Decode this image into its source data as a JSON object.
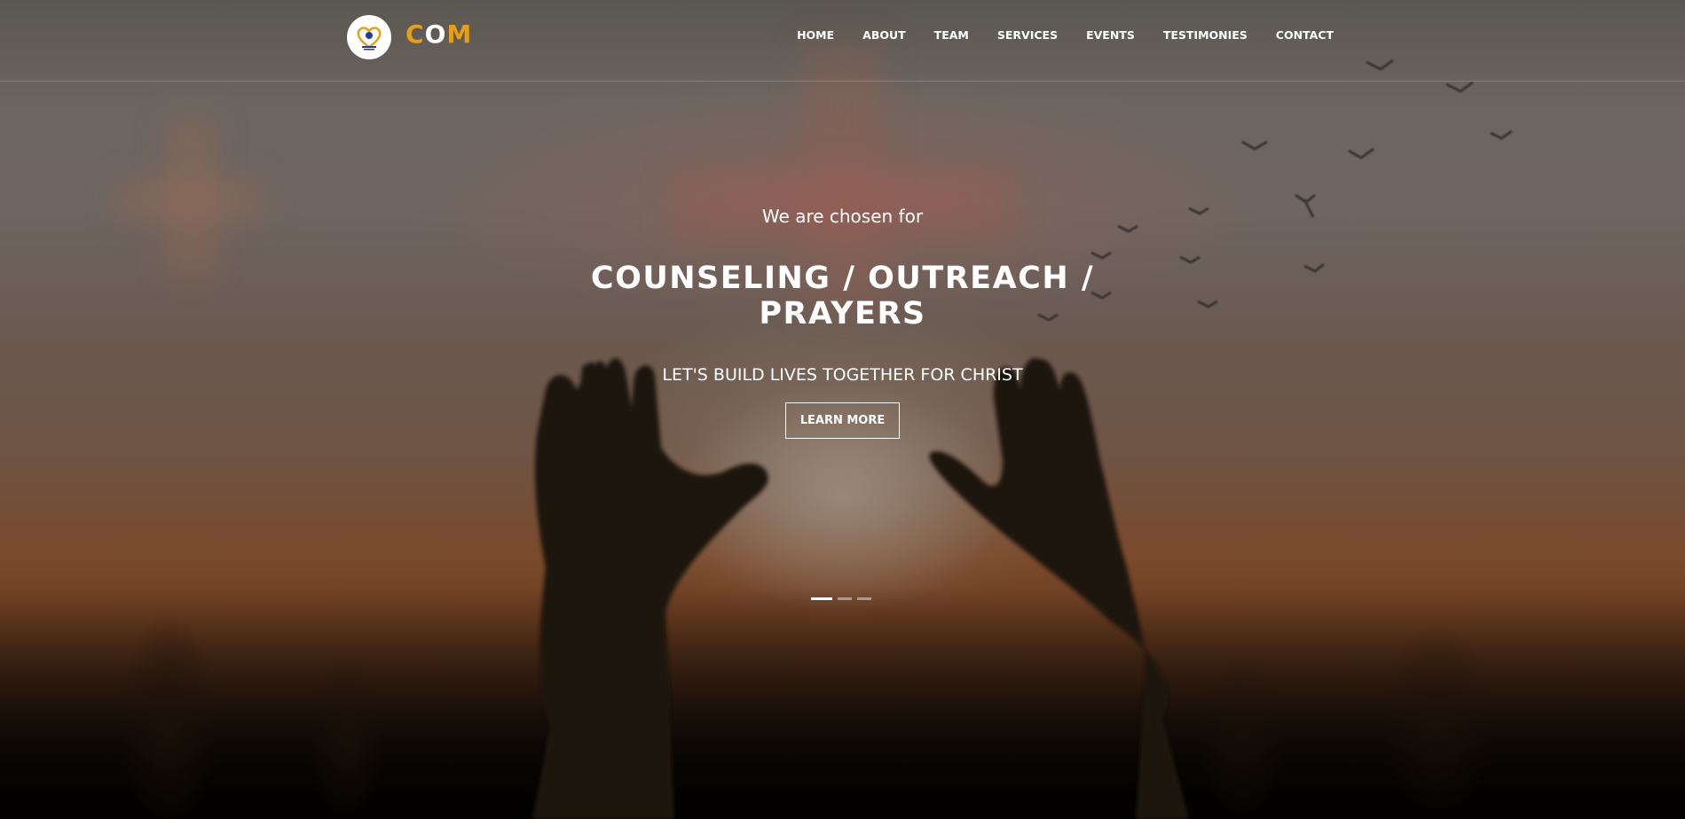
{
  "header": {
    "logo_alt": "CHRIST OUTREACH MINISTRY",
    "brand": {
      "part1": "C",
      "part2": "O",
      "part3": "M"
    },
    "nav": [
      {
        "label": "HOME"
      },
      {
        "label": "ABOUT"
      },
      {
        "label": "TEAM"
      },
      {
        "label": "SERVICES"
      },
      {
        "label": "EVENTS"
      },
      {
        "label": "TESTIMONIES"
      },
      {
        "label": "CONTACT"
      }
    ]
  },
  "hero": {
    "subtitle": "We are chosen for",
    "title_line1": "COUNSELING / OUTREACH /",
    "title_line2": "PRAYERS",
    "tagline": "LET'S BUILD LIVES TOGETHER FOR CHRIST",
    "button_label": "LEARN MORE",
    "slides": 3,
    "active_slide": 1
  },
  "colors": {
    "brand_gold": "#e6a017",
    "text_white": "#ffffff"
  }
}
